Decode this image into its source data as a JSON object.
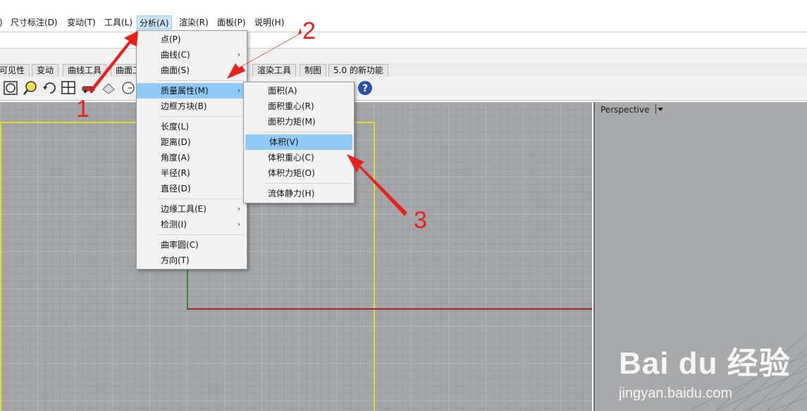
{
  "menubar": {
    "items": [
      "尺寸标注(D)",
      "变动(T)",
      "工具(L)",
      "分析(A)",
      "渲染(R)",
      "面板(P)",
      "说明(H)"
    ],
    "active_index": 3
  },
  "toolbar_tabs": [
    "可见性",
    "变动",
    "曲线工具",
    "曲面工",
    "渲染工具",
    "制图",
    "5.0 的新功能"
  ],
  "analysis_menu": {
    "items": [
      {
        "label": "点(P)",
        "has_sub": false
      },
      {
        "label": "曲线(C)",
        "has_sub": true
      },
      {
        "label": "曲面(S)",
        "has_sub": false
      },
      {
        "label": "质量属性(M)",
        "has_sub": true,
        "highlighted": true
      },
      {
        "label": "边框方块(B)",
        "has_sub": false
      },
      {
        "label": "长度(L)",
        "has_sub": false
      },
      {
        "label": "距离(D)",
        "has_sub": false
      },
      {
        "label": "角度(A)",
        "has_sub": false
      },
      {
        "label": "半径(R)",
        "has_sub": false
      },
      {
        "label": "直径(D)",
        "has_sub": false
      },
      {
        "label": "边缘工具(E)",
        "has_sub": true
      },
      {
        "label": "检测(I)",
        "has_sub": true
      },
      {
        "label": "曲率圆(C)",
        "has_sub": false
      },
      {
        "label": "方向(T)",
        "has_sub": false
      }
    ],
    "submenu_arrow": "›"
  },
  "mass_props_menu": {
    "items": [
      {
        "label": "面积(A)"
      },
      {
        "label": "面积重心(R)"
      },
      {
        "label": "面积力矩(M)"
      },
      {
        "label": "体积(V)",
        "highlighted": true
      },
      {
        "label": "体积重心(C)"
      },
      {
        "label": "体积力矩(O)"
      },
      {
        "label": "流体静力(H)"
      }
    ]
  },
  "viewport": {
    "right_label": "Perspective"
  },
  "annotations": {
    "one": "1",
    "two": "2",
    "three": "3"
  },
  "watermark": {
    "main": "Bai du 经验",
    "sub": "jingyan.baidu.com"
  },
  "colors": {
    "menu_highlight": "#91c9f7",
    "annotation": "#e8201a",
    "viewport_bg": "#a3a5a8"
  }
}
